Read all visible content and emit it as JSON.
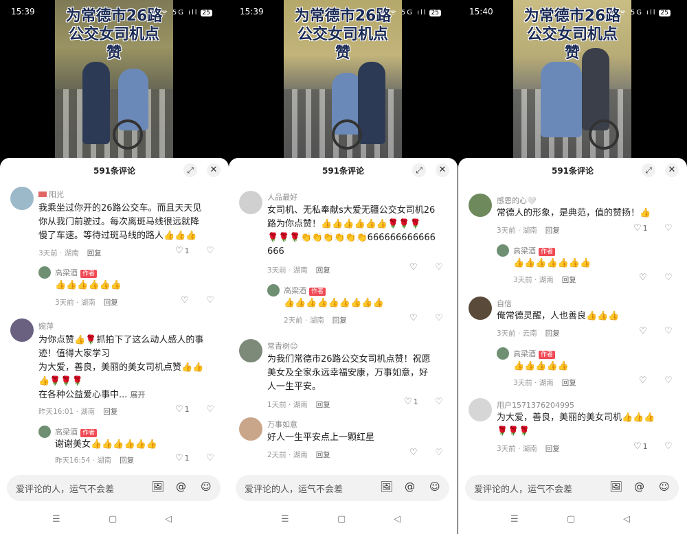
{
  "screens": [
    {
      "status": {
        "time": "15:39",
        "icons": "⊛ ᯤ 5G ıll",
        "battery": "25"
      },
      "video_title": [
        "为常德市26路",
        "公交女司机点",
        "赞"
      ],
      "comment_count": "591条评论",
      "comments": [
        {
          "user": "阳光",
          "text": [
            "我乘坐过你开的26路公交车。而且天天见",
            "你从我门前驶过。每次离斑马线很远就降",
            "慢了车速。等待过斑马线的路人👍👍👍"
          ],
          "time": "3天前 · 湖南",
          "reply": "回复",
          "likes": "1"
        },
        {
          "reply_user": "高梁酒",
          "author_tag": "作者",
          "text": [
            "👍👍👍👍👍👍"
          ],
          "time": "3天前 · 湖南",
          "reply": "回复"
        },
        {
          "user": "婉萍",
          "text": [
            "为你点赞👍🌹抓拍下了这么动人感人的事",
            "迹！值得大家学习",
            "为大爱，善良，美丽的美女司机点赞👍👍",
            "👍🌹🌹🌹",
            "在各种公益爱心事中..."
          ],
          "more": "展开",
          "time": "昨天16:01 · 湖南",
          "reply": "回复",
          "likes": "1"
        },
        {
          "reply_user": "高梁酒",
          "author_tag": "作者",
          "text": [
            "谢谢美女👍👍👍👍👍👍"
          ],
          "time": "昨天16:54 · 湖南",
          "reply": "回复",
          "likes": "1"
        }
      ]
    },
    {
      "status": {
        "time": "15:39",
        "icons": "⊛ ᯤ 5G ıll",
        "battery": "25"
      },
      "video_title": [
        "为常德市26路",
        "公交女司机点",
        "赞"
      ],
      "comment_count": "591条评论",
      "comments": [
        {
          "user": "人品最好",
          "text": [
            "女司机、无私奉献s大爱无疆公交女司机26",
            "路为你点赞！👍👍👍👍👍👍🌹🌹🌹",
            "🌹🌹🌹👏👏👏👏👏👏666666666666",
            "666"
          ],
          "time": "3天前 · 湖南",
          "reply": "回复"
        },
        {
          "reply_user": "高梁酒",
          "author_tag": "作者",
          "text": [
            "👍👍👍👍👍👍👍👍👍"
          ],
          "time": "2天前 · 湖南",
          "reply": "回复"
        },
        {
          "user": "常青树😊",
          "text": [
            "为我们常德市26路公交女司机点赞！祝愿",
            "美女及全家永远幸福安康，万事如意，好",
            "人一生平安。"
          ],
          "time": "1天前 · 湖南",
          "reply": "回复",
          "likes": "1"
        },
        {
          "user": "万事如意",
          "text": [
            "好人一生平安点上一颗红星"
          ],
          "time": "2天前 · 湖南",
          "reply": "回复"
        }
      ]
    },
    {
      "status": {
        "time": "15:40",
        "icons": "⊛ ᯤ 5G ıll",
        "battery": "25"
      },
      "video_title": [
        "为常德市26路",
        "公交女司机点",
        "赞"
      ],
      "comment_count": "591条评论",
      "comments": [
        {
          "user": "感恩的心🤍",
          "text": [
            "常德人的形象，是典范，值的赞扬！👍"
          ],
          "time": "3天前 · 湖南",
          "reply": "回复",
          "likes": "1"
        },
        {
          "reply_user": "高梁酒",
          "author_tag": "作者",
          "text": [
            "👍👍👍👍👍👍👍"
          ],
          "time": "3天前 · 湖南",
          "reply": "回复"
        },
        {
          "user": "自信",
          "text": [
            "俺常德灵醒，人也善良👍👍👍"
          ],
          "time": "3天前 · 云南",
          "reply": "回复"
        },
        {
          "reply_user": "高梁酒",
          "author_tag": "作者",
          "text": [
            "👍👍👍👍👍"
          ],
          "time": "3天前 · 湖南",
          "reply": "回复"
        },
        {
          "user": "用户1571376204995",
          "text": [
            "为大爱，善良，美丽的美女司机👍👍👍",
            "🌹🌹🌹"
          ],
          "time": "3天前 · 湖南",
          "reply": "回复",
          "likes": "1"
        }
      ]
    }
  ],
  "input_placeholder": "爱评论的人，运气不会差",
  "icons": {
    "expand": "expand-icon",
    "close": "close-icon",
    "image": "image-icon",
    "at": "at-icon",
    "emoji": "emoji-icon",
    "like": "heart-icon",
    "dislike": "broken-heart-icon"
  },
  "nav": {
    "menu": "☰",
    "home": "▢",
    "back": "◁"
  },
  "colors": {
    "author_tag": "#f04a55",
    "title_text": "#1a2a55"
  }
}
